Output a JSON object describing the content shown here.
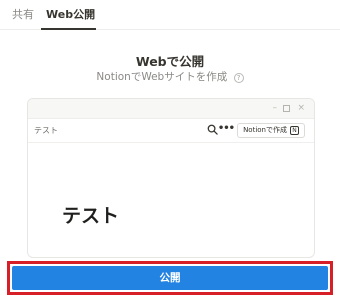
{
  "tabs": [
    {
      "label": "共有"
    },
    {
      "label": "Web公開"
    }
  ],
  "header": {
    "title": "Webで公開",
    "subtitle": "NotionでWebサイトを作成",
    "help_icon": "help-circle-icon"
  },
  "preview": {
    "window_controls": [
      "minimize-icon",
      "maximize-icon",
      "close-icon"
    ],
    "tab_title": "テスト",
    "create_button_label": "Notionで作成",
    "page_title": "テスト"
  },
  "footer": {
    "publish_label": "公開"
  },
  "colors": {
    "accent": "#2383e2",
    "highlight_border": "#d61f27",
    "text": "#37352f",
    "muted_text": "#8a8985"
  }
}
